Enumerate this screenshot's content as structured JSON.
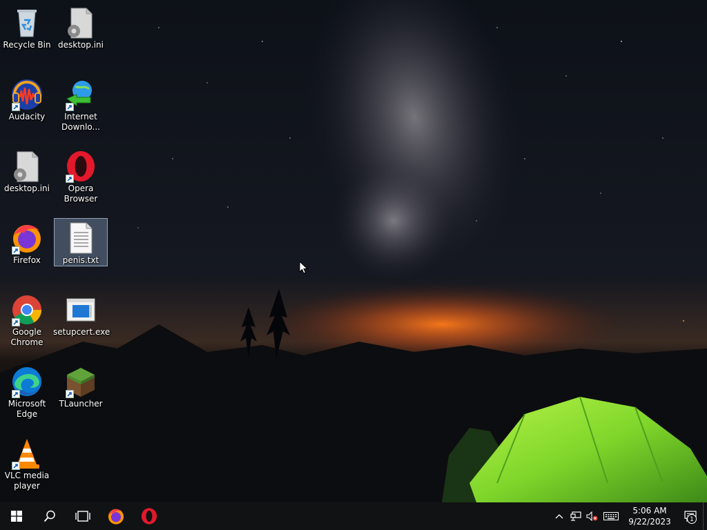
{
  "desktop": {
    "icons": [
      {
        "id": "recycle-bin",
        "label": "Recycle Bin",
        "icon": "recycle-bin-icon",
        "shortcut": false
      },
      {
        "id": "desktop-ini-1",
        "label": "desktop.ini",
        "icon": "settings-file-icon",
        "shortcut": false
      },
      {
        "id": "audacity",
        "label": "Audacity",
        "icon": "audacity-icon",
        "shortcut": true
      },
      {
        "id": "internet-download-manager",
        "label": "Internet Downlo...",
        "icon": "internet-download-manager-icon",
        "shortcut": true
      },
      {
        "id": "desktop-ini-2",
        "label": "desktop.ini",
        "icon": "settings-file-icon",
        "shortcut": false
      },
      {
        "id": "opera-browser",
        "label": "Opera Browser",
        "icon": "opera-icon",
        "shortcut": true
      },
      {
        "id": "firefox",
        "label": "Firefox",
        "icon": "firefox-icon",
        "shortcut": true
      },
      {
        "id": "penis-txt",
        "label": "penis.txt",
        "icon": "text-file-icon",
        "shortcut": false,
        "selected": true
      },
      {
        "id": "google-chrome",
        "label": "Google Chrome",
        "icon": "chrome-icon",
        "shortcut": true
      },
      {
        "id": "setupcert-exe",
        "label": "setupcert.exe",
        "icon": "exe-window-icon",
        "shortcut": false
      },
      {
        "id": "microsoft-edge",
        "label": "Microsoft Edge",
        "icon": "edge-icon",
        "shortcut": true
      },
      {
        "id": "tlauncher",
        "label": "TLauncher",
        "icon": "minecraft-grass-block-icon",
        "shortcut": true
      },
      {
        "id": "vlc",
        "label": "VLC media player",
        "icon": "vlc-cone-icon",
        "shortcut": true
      }
    ]
  },
  "taskbar": {
    "start": "windows-logo-icon",
    "search": "search-icon",
    "task_view": "task-view-icon",
    "pinned": [
      {
        "name": "Firefox",
        "icon": "firefox-icon"
      },
      {
        "name": "Opera",
        "icon": "opera-icon"
      }
    ],
    "tray": {
      "icons": [
        "chevron-up-icon",
        "network-icon",
        "speaker-muted-icon",
        "keyboard-icon"
      ],
      "time": "5:06 AM",
      "date": "9/22/2023",
      "notification_count": "1"
    }
  },
  "colors": {
    "taskbar": "#101214",
    "opera_red": "#e3192b",
    "tent_green": "#7fd62a",
    "glow_orange": "#e0621c"
  }
}
